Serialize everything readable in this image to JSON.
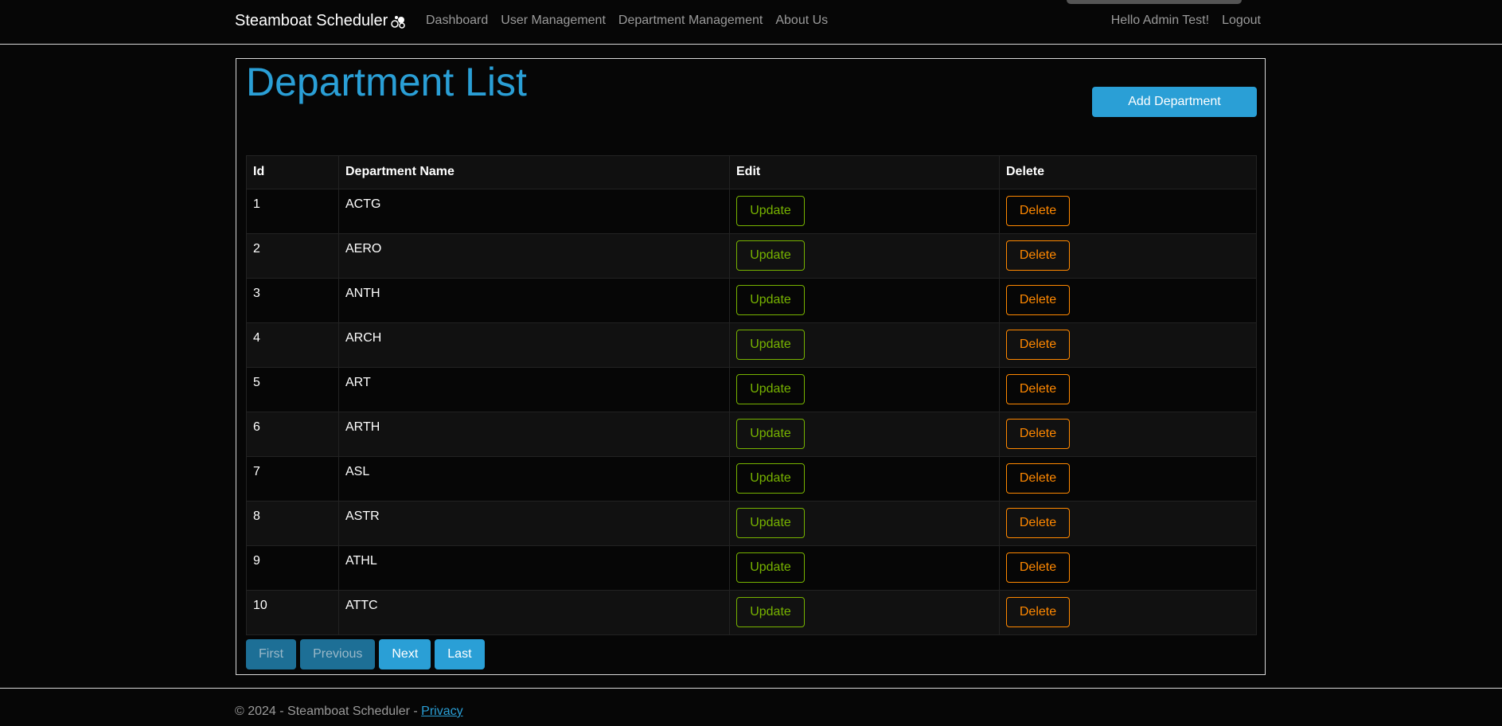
{
  "brand": {
    "name": "Steamboat Scheduler"
  },
  "nav": {
    "links": [
      "Dashboard",
      "User Management",
      "Department Management",
      "About Us"
    ],
    "greeting": "Hello Admin Test!",
    "logout": "Logout"
  },
  "main": {
    "title": "Department List",
    "add_button": "Add Department",
    "table": {
      "headers": [
        "Id",
        "Department Name",
        "Edit",
        "Delete"
      ],
      "update_label": "Update",
      "delete_label": "Delete",
      "rows": [
        {
          "id": "1",
          "name": "ACTG"
        },
        {
          "id": "2",
          "name": "AERO"
        },
        {
          "id": "3",
          "name": "ANTH"
        },
        {
          "id": "4",
          "name": "ARCH"
        },
        {
          "id": "5",
          "name": "ART"
        },
        {
          "id": "6",
          "name": "ARTH"
        },
        {
          "id": "7",
          "name": "ASL"
        },
        {
          "id": "8",
          "name": "ASTR"
        },
        {
          "id": "9",
          "name": "ATHL"
        },
        {
          "id": "10",
          "name": "ATTC"
        }
      ]
    },
    "pagination": {
      "first": "First",
      "previous": "Previous",
      "next": "Next",
      "last": "Last"
    }
  },
  "footer": {
    "text": "© 2024 - Steamboat Scheduler - ",
    "privacy": "Privacy"
  },
  "colors": {
    "accent": "#2a9fd6",
    "update": "#77b300",
    "delete": "#ff8800"
  }
}
